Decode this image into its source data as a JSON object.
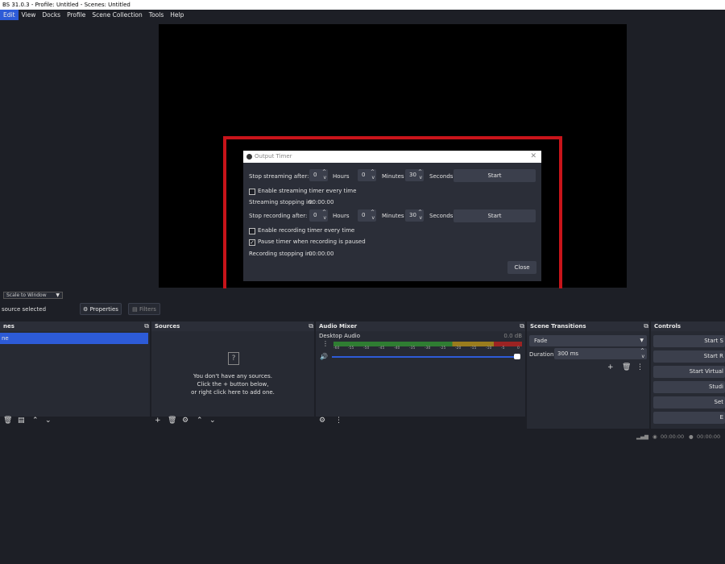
{
  "window": {
    "title": "BS 31.0.3 - Profile: Untitled - Scenes: Untitled"
  },
  "menu": [
    "Edit",
    "View",
    "Docks",
    "Profile",
    "Scene Collection",
    "Tools",
    "Help"
  ],
  "preview_bar": {
    "scale_label": "Scale to Window",
    "no_source": "source selected",
    "properties": "Properties",
    "filters": "Filters"
  },
  "dialog": {
    "title": "Output Timer",
    "stream_label": "Stop streaming after:",
    "stream_hours": "0",
    "stream_minutes": "0",
    "stream_seconds": "30",
    "hours": "Hours",
    "minutes": "Minutes",
    "seconds": "Seconds",
    "start": "Start",
    "enable_stream": "Enable streaming timer every time",
    "stream_stopping": "Streaming stopping in:",
    "stream_time": "00:00:00",
    "record_label": "Stop recording after:",
    "record_hours": "0",
    "record_minutes": "0",
    "record_seconds": "30",
    "enable_record": "Enable recording timer every time",
    "pause_timer": "Pause timer when recording is paused",
    "record_stopping": "Recording stopping in:",
    "record_time": "00:00:00",
    "close": "Close"
  },
  "scenes": {
    "title": "nes",
    "item": "ne"
  },
  "sources": {
    "title": "Sources",
    "empty1": "You don't have any sources.",
    "empty2": "Click the + button below,",
    "empty3": "or right click here to add one."
  },
  "mixer": {
    "title": "Audio Mixer",
    "channel": "Desktop Audio",
    "db": "0.0 dB",
    "ticks": [
      "-60",
      "-55",
      "-50",
      "-45",
      "-40",
      "-35",
      "-30",
      "-25",
      "-20",
      "-15",
      "-10",
      "-5",
      "0"
    ]
  },
  "transitions": {
    "title": "Scene Transitions",
    "selected": "Fade",
    "duration_label": "Duration",
    "duration": "300 ms"
  },
  "controls": {
    "title": "Controls",
    "buttons": [
      "Start S",
      "Start R",
      "Start Virtual",
      "Studi",
      "Set",
      "E"
    ]
  },
  "status": {
    "stream_time": "00:00:00",
    "rec_time": "00:00:00"
  },
  "colors": {
    "accent": "#2d5bd7",
    "highlight": "#c8141a"
  }
}
